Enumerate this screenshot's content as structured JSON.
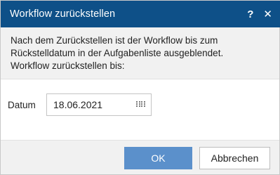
{
  "dialog": {
    "title": "Workflow zurückstellen",
    "help_label": "?",
    "close_label": "✕"
  },
  "info": {
    "line1": "Nach dem Zurückstellen ist der Workflow bis zum",
    "line2": "Rückstelldatum in der Aufgabenliste ausgeblendet.",
    "line3": "Workflow zurückstellen bis:"
  },
  "field": {
    "label": "Datum",
    "value": "18.06.2021",
    "icon": "calendar-icon"
  },
  "buttons": {
    "ok_label": "OK",
    "cancel_label": "Abbrechen"
  },
  "colors": {
    "titlebar": "#0e5088",
    "primary_button": "#5b90cb",
    "panel_background": "#f1f1f1"
  }
}
